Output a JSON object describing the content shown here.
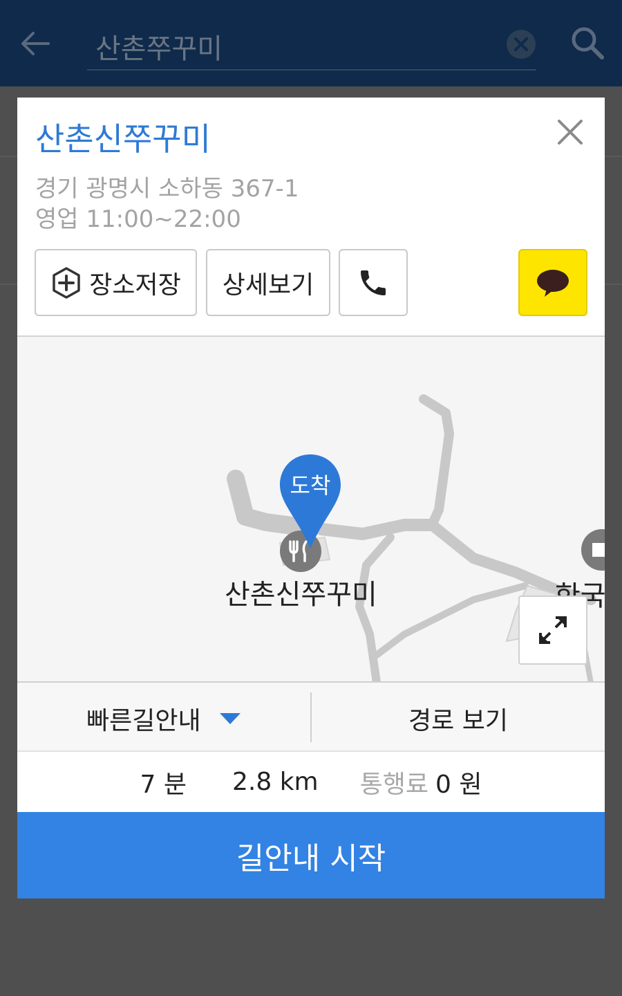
{
  "appbar": {
    "search_query": "산촌쭈꾸미"
  },
  "place": {
    "title": "산촌신쭈꾸미",
    "address": "경기 광명시 소하동 367-1",
    "hours": "영업 11:00~22:00"
  },
  "actions": {
    "save_label": "장소저장",
    "detail_label": "상세보기"
  },
  "map": {
    "pin_label": "도착",
    "place_label": "산촌신쭈꾸미",
    "nearby_label": "한국"
  },
  "route": {
    "mode_label": "빠른길안내",
    "view_label": "경로 보기"
  },
  "stats": {
    "time": "7 분",
    "distance": "2.8 km",
    "toll_label": "통행료",
    "toll_value": "0 원"
  },
  "start": {
    "label": "길안내 시작"
  },
  "colors": {
    "accent": "#3283e3",
    "title_blue": "#2f7ad4",
    "kakao_yellow": "#fee500",
    "appbar": "#0f2a4b"
  }
}
